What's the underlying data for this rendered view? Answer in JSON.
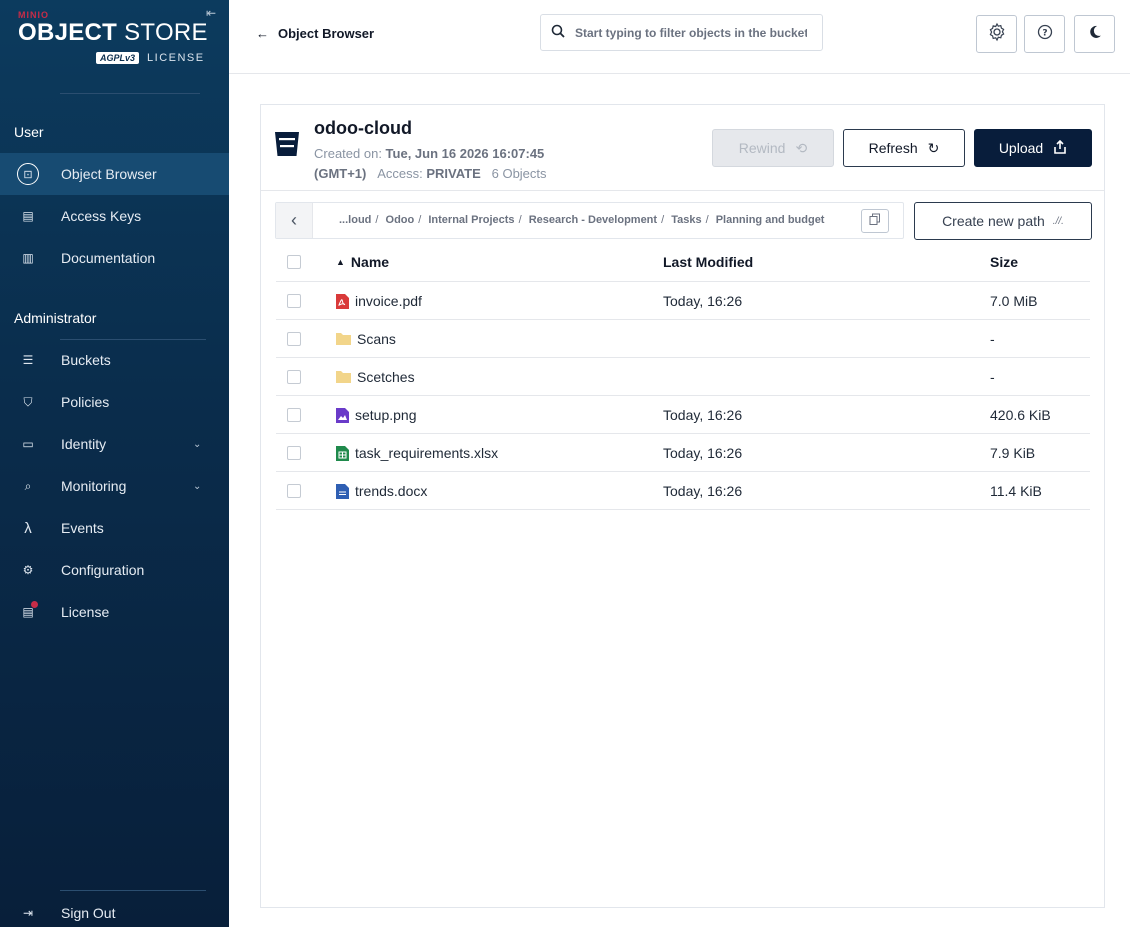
{
  "brand": {
    "minio": "MINIO",
    "product_bold": "OBJECT",
    "product_rest": " STORE",
    "license_badge": "AGPLv3",
    "license_text": "LICENSE"
  },
  "sidebar": {
    "user_section": "User",
    "admin_section": "Administrator",
    "user_items": [
      {
        "label": "Object Browser",
        "icon": "object-browser-icon",
        "active": true
      },
      {
        "label": "Access Keys",
        "icon": "access-keys-icon"
      },
      {
        "label": "Documentation",
        "icon": "documentation-icon"
      }
    ],
    "admin_items": [
      {
        "label": "Buckets",
        "icon": "bucket-icon"
      },
      {
        "label": "Policies",
        "icon": "policies-icon"
      },
      {
        "label": "Identity",
        "icon": "identity-icon",
        "expandable": true
      },
      {
        "label": "Monitoring",
        "icon": "monitoring-icon",
        "expandable": true
      },
      {
        "label": "Events",
        "icon": "lambda-icon"
      },
      {
        "label": "Configuration",
        "icon": "gear-icon"
      },
      {
        "label": "License",
        "icon": "license-icon"
      }
    ],
    "sign_out": "Sign Out"
  },
  "topbar": {
    "back_label": "Object Browser",
    "search_placeholder": "Start typing to filter objects in the bucket"
  },
  "bucket": {
    "name": "odoo-cloud",
    "created_label": "Created on: ",
    "created_value": "Tue, Jun 16 2026 16:07:45",
    "timezone": "(GMT+1)",
    "access_label": "Access: ",
    "access_value": "PRIVATE",
    "objects": "6 Objects"
  },
  "actions": {
    "rewind": "Rewind",
    "refresh": "Refresh",
    "upload": "Upload",
    "create_path": "Create new path"
  },
  "breadcrumb": [
    "...loud",
    "Odoo",
    "Internal Projects",
    "Research - Development",
    "Tasks",
    "Planning and budget"
  ],
  "table": {
    "columns": {
      "name": "Name",
      "modified": "Last Modified",
      "size": "Size"
    },
    "rows": [
      {
        "name": "invoice.pdf",
        "type": "pdf-file-icon",
        "modified": "Today, 16:26",
        "size": "7.0 MiB"
      },
      {
        "name": "Scans",
        "type": "folder-icon",
        "modified": "",
        "size": "-"
      },
      {
        "name": "Scetches",
        "type": "folder-icon",
        "modified": "",
        "size": "-"
      },
      {
        "name": "setup.png",
        "type": "image-file-icon",
        "modified": "Today, 16:26",
        "size": "420.6 KiB"
      },
      {
        "name": "task_requirements.xlsx",
        "type": "spreadsheet-file-icon",
        "modified": "Today, 16:26",
        "size": "7.9 KiB"
      },
      {
        "name": "trends.docx",
        "type": "document-file-icon",
        "modified": "Today, 16:26",
        "size": "11.4 KiB"
      }
    ]
  },
  "colors": {
    "sidebar_top": "#0c3b5e",
    "sidebar_bottom": "#081f3a",
    "primary": "#081d3b",
    "brand_red": "#c72c48"
  }
}
